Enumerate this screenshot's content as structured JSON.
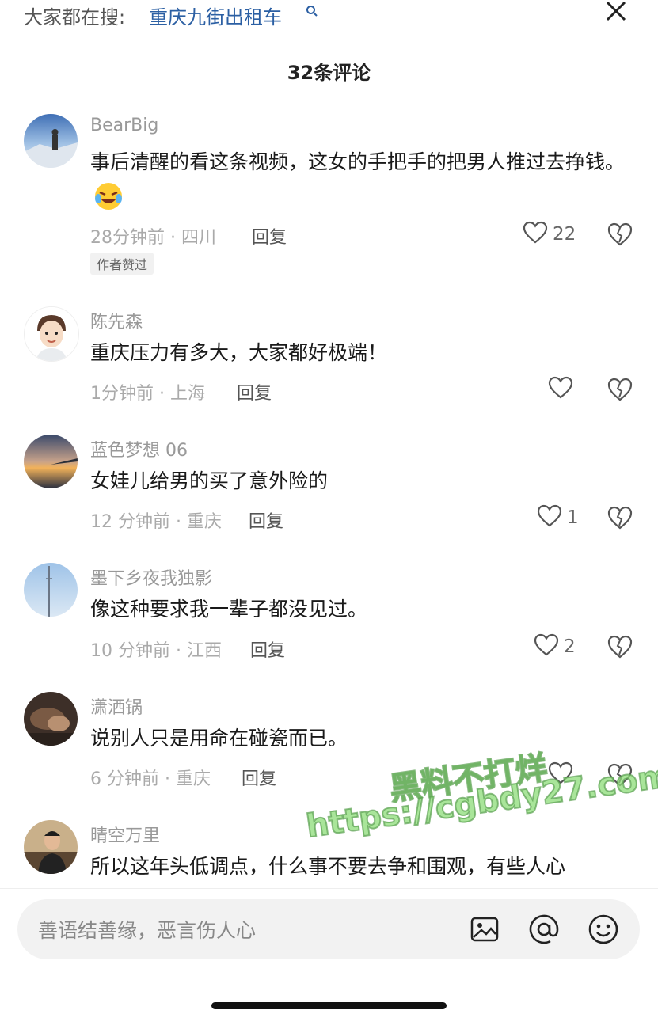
{
  "header": {
    "hot_search_label": "大家都在搜:",
    "hot_search_query": "重庆九街出租车",
    "comment_count_title": "32条评论"
  },
  "icons": {
    "search": "search-icon",
    "close": "close-icon",
    "like": "heart-icon",
    "dislike": "broken-heart-icon",
    "image": "image-icon",
    "mention": "at-icon",
    "emoji": "emoji-icon"
  },
  "comments": [
    {
      "username": "BearBig",
      "text": "事后清醒的看这条视频，这女的手把手的把男人推过去挣钱。",
      "emoji": "laughing-face-emoji",
      "time": "28分钟前 · 四川",
      "reply": "回复",
      "likes": "22",
      "badge": "作者赞过"
    },
    {
      "username": "陈先森",
      "text": "重庆压力有多大，大家都好极端！",
      "time": "1分钟前 · 上海",
      "reply": "回复",
      "likes": ""
    },
    {
      "username": "蓝色梦想 06",
      "text": "女娃儿给男的买了意外险的",
      "time": "12 分钟前 · 重庆",
      "reply": "回复",
      "likes": "1"
    },
    {
      "username": "墨下乡夜我独影",
      "text": "像这种要求我一辈子都没见过。",
      "time": "10 分钟前 · 江西",
      "reply": "回复",
      "likes": "2"
    },
    {
      "username": "潇洒锅",
      "text": "说别人只是用命在碰瓷而已。",
      "time": "6 分钟前 · 重庆",
      "reply": "回复",
      "likes": ""
    },
    {
      "username": "晴空万里",
      "text": "所以这年头低调点，什么事不要去争和围观，有些人心"
    }
  ],
  "watermark": {
    "line1": "黑料不打烊",
    "line2": "https://cgbdy27.com"
  },
  "input": {
    "placeholder": "善语结善缘，恶言伤人心"
  },
  "colors": {
    "link": "#2b5fa3",
    "meta": "#aaaaaa",
    "watermark": "#8cdc78"
  }
}
